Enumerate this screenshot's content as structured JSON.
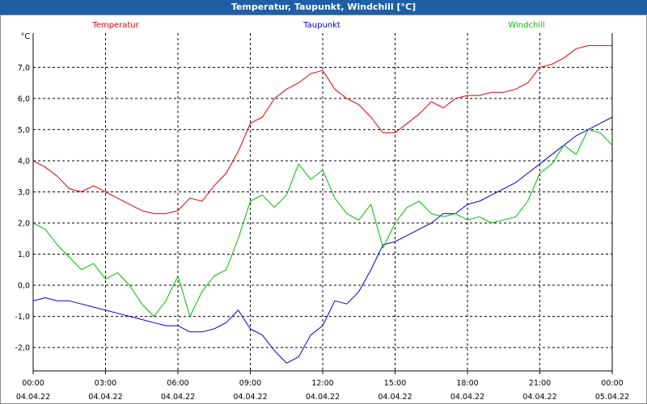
{
  "window": {
    "title": "Temperatur, Taupunkt, Windchill [°C]"
  },
  "chart_data": {
    "type": "line",
    "title": "Temperatur, Taupunkt, Windchill [°C]",
    "ylabel": "°C",
    "xlabel": "",
    "ylim": [
      -2.75,
      8.1
    ],
    "xlim": [
      0,
      24
    ],
    "grid": true,
    "legend_position": "top",
    "y_ticks": [
      {
        "value": 7.0,
        "label": "7,0"
      },
      {
        "value": 6.0,
        "label": "6,0"
      },
      {
        "value": 5.0,
        "label": "5,0"
      },
      {
        "value": 4.0,
        "label": "4,0"
      },
      {
        "value": 3.0,
        "label": "3,0"
      },
      {
        "value": 2.0,
        "label": "2,0"
      },
      {
        "value": 1.0,
        "label": "1,0"
      },
      {
        "value": 0.0,
        "label": "0,0"
      },
      {
        "value": -1.0,
        "label": "-1,0"
      },
      {
        "value": -2.0,
        "label": "-2,0"
      }
    ],
    "x_ticks": [
      {
        "value": 0,
        "time": "00:00",
        "date": "04.04.22"
      },
      {
        "value": 3,
        "time": "03:00",
        "date": "04.04.22"
      },
      {
        "value": 6,
        "time": "06:00",
        "date": "04.04.22"
      },
      {
        "value": 9,
        "time": "09:00",
        "date": "04.04.22"
      },
      {
        "value": 12,
        "time": "12:00",
        "date": "04.04.22"
      },
      {
        "value": 15,
        "time": "15:00",
        "date": "04.04.22"
      },
      {
        "value": 18,
        "time": "18:00",
        "date": "04.04.22"
      },
      {
        "value": 21,
        "time": "21:00",
        "date": "04.04.22"
      },
      {
        "value": 24,
        "time": "00:00",
        "date": "05.04.22"
      }
    ],
    "series": [
      {
        "name": "Temperatur",
        "color": "#e00000",
        "points": [
          [
            0,
            4.0
          ],
          [
            0.5,
            3.8
          ],
          [
            1.0,
            3.5
          ],
          [
            1.5,
            3.1
          ],
          [
            2.0,
            3.0
          ],
          [
            2.5,
            3.2
          ],
          [
            3.0,
            3.0
          ],
          [
            3.5,
            2.8
          ],
          [
            4.0,
            2.6
          ],
          [
            4.5,
            2.4
          ],
          [
            5.0,
            2.3
          ],
          [
            5.5,
            2.3
          ],
          [
            6.0,
            2.4
          ],
          [
            6.5,
            2.8
          ],
          [
            7.0,
            2.7
          ],
          [
            7.5,
            3.2
          ],
          [
            8.0,
            3.6
          ],
          [
            8.5,
            4.3
          ],
          [
            9.0,
            5.2
          ],
          [
            9.5,
            5.4
          ],
          [
            10.0,
            6.0
          ],
          [
            10.5,
            6.3
          ],
          [
            11.0,
            6.5
          ],
          [
            11.5,
            6.8
          ],
          [
            12.0,
            6.9
          ],
          [
            12.5,
            6.3
          ],
          [
            13.0,
            6.0
          ],
          [
            13.5,
            5.8
          ],
          [
            14.0,
            5.4
          ],
          [
            14.5,
            4.9
          ],
          [
            15.0,
            4.9
          ],
          [
            15.5,
            5.2
          ],
          [
            16.0,
            5.5
          ],
          [
            16.5,
            5.9
          ],
          [
            17.0,
            5.7
          ],
          [
            17.5,
            6.0
          ],
          [
            18.0,
            6.1
          ],
          [
            18.5,
            6.1
          ],
          [
            19.0,
            6.2
          ],
          [
            19.5,
            6.2
          ],
          [
            20.0,
            6.3
          ],
          [
            20.5,
            6.5
          ],
          [
            21.0,
            7.0
          ],
          [
            21.5,
            7.1
          ],
          [
            22.0,
            7.3
          ],
          [
            22.5,
            7.6
          ],
          [
            23.0,
            7.7
          ],
          [
            23.5,
            7.7
          ],
          [
            24.0,
            7.7
          ]
        ]
      },
      {
        "name": "Taupunkt",
        "color": "#0000cc",
        "points": [
          [
            0,
            -0.5
          ],
          [
            0.5,
            -0.4
          ],
          [
            1.0,
            -0.5
          ],
          [
            1.5,
            -0.5
          ],
          [
            2.0,
            -0.6
          ],
          [
            2.5,
            -0.7
          ],
          [
            3.0,
            -0.8
          ],
          [
            3.5,
            -0.9
          ],
          [
            4.0,
            -1.0
          ],
          [
            4.5,
            -1.1
          ],
          [
            5.0,
            -1.2
          ],
          [
            5.5,
            -1.3
          ],
          [
            6.0,
            -1.3
          ],
          [
            6.5,
            -1.5
          ],
          [
            7.0,
            -1.5
          ],
          [
            7.5,
            -1.4
          ],
          [
            8.0,
            -1.2
          ],
          [
            8.5,
            -0.8
          ],
          [
            9.0,
            -1.4
          ],
          [
            9.5,
            -1.6
          ],
          [
            10.0,
            -2.1
          ],
          [
            10.5,
            -2.5
          ],
          [
            11.0,
            -2.3
          ],
          [
            11.5,
            -1.6
          ],
          [
            12.0,
            -1.3
          ],
          [
            12.5,
            -0.5
          ],
          [
            13.0,
            -0.6
          ],
          [
            13.5,
            -0.2
          ],
          [
            14.0,
            0.5
          ],
          [
            14.5,
            1.3
          ],
          [
            15.0,
            1.4
          ],
          [
            15.5,
            1.6
          ],
          [
            16.0,
            1.8
          ],
          [
            16.5,
            2.0
          ],
          [
            17.0,
            2.3
          ],
          [
            17.5,
            2.3
          ],
          [
            18.0,
            2.6
          ],
          [
            18.5,
            2.7
          ],
          [
            19.0,
            2.9
          ],
          [
            19.5,
            3.1
          ],
          [
            20.0,
            3.3
          ],
          [
            20.5,
            3.6
          ],
          [
            21.0,
            3.9
          ],
          [
            21.5,
            4.2
          ],
          [
            22.0,
            4.5
          ],
          [
            22.5,
            4.8
          ],
          [
            23.0,
            5.0
          ],
          [
            23.5,
            5.2
          ],
          [
            24.0,
            5.4
          ]
        ]
      },
      {
        "name": "Windchill",
        "color": "#00bb00",
        "points": [
          [
            0,
            2.0
          ],
          [
            0.5,
            1.8
          ],
          [
            1.0,
            1.3
          ],
          [
            1.5,
            0.9
          ],
          [
            2.0,
            0.5
          ],
          [
            2.5,
            0.7
          ],
          [
            3.0,
            0.2
          ],
          [
            3.5,
            0.4
          ],
          [
            4.0,
            0.0
          ],
          [
            4.5,
            -0.6
          ],
          [
            5.0,
            -1.0
          ],
          [
            5.5,
            -0.5
          ],
          [
            6.0,
            0.3
          ],
          [
            6.5,
            -1.0
          ],
          [
            7.0,
            -0.2
          ],
          [
            7.5,
            0.3
          ],
          [
            8.0,
            0.5
          ],
          [
            8.5,
            1.5
          ],
          [
            9.0,
            2.7
          ],
          [
            9.5,
            2.9
          ],
          [
            10.0,
            2.5
          ],
          [
            10.5,
            2.9
          ],
          [
            11.0,
            3.9
          ],
          [
            11.5,
            3.4
          ],
          [
            12.0,
            3.7
          ],
          [
            12.5,
            2.8
          ],
          [
            13.0,
            2.3
          ],
          [
            13.5,
            2.1
          ],
          [
            14.0,
            2.6
          ],
          [
            14.5,
            1.2
          ],
          [
            15.0,
            2.0
          ],
          [
            15.5,
            2.5
          ],
          [
            16.0,
            2.7
          ],
          [
            16.5,
            2.3
          ],
          [
            17.0,
            2.2
          ],
          [
            17.5,
            2.3
          ],
          [
            18.0,
            2.1
          ],
          [
            18.5,
            2.2
          ],
          [
            19.0,
            2.0
          ],
          [
            19.5,
            2.1
          ],
          [
            20.0,
            2.2
          ],
          [
            20.5,
            2.7
          ],
          [
            21.0,
            3.6
          ],
          [
            21.5,
            3.9
          ],
          [
            22.0,
            4.5
          ],
          [
            22.5,
            4.2
          ],
          [
            23.0,
            5.0
          ],
          [
            23.5,
            4.9
          ],
          [
            24.0,
            4.5
          ]
        ]
      }
    ]
  }
}
